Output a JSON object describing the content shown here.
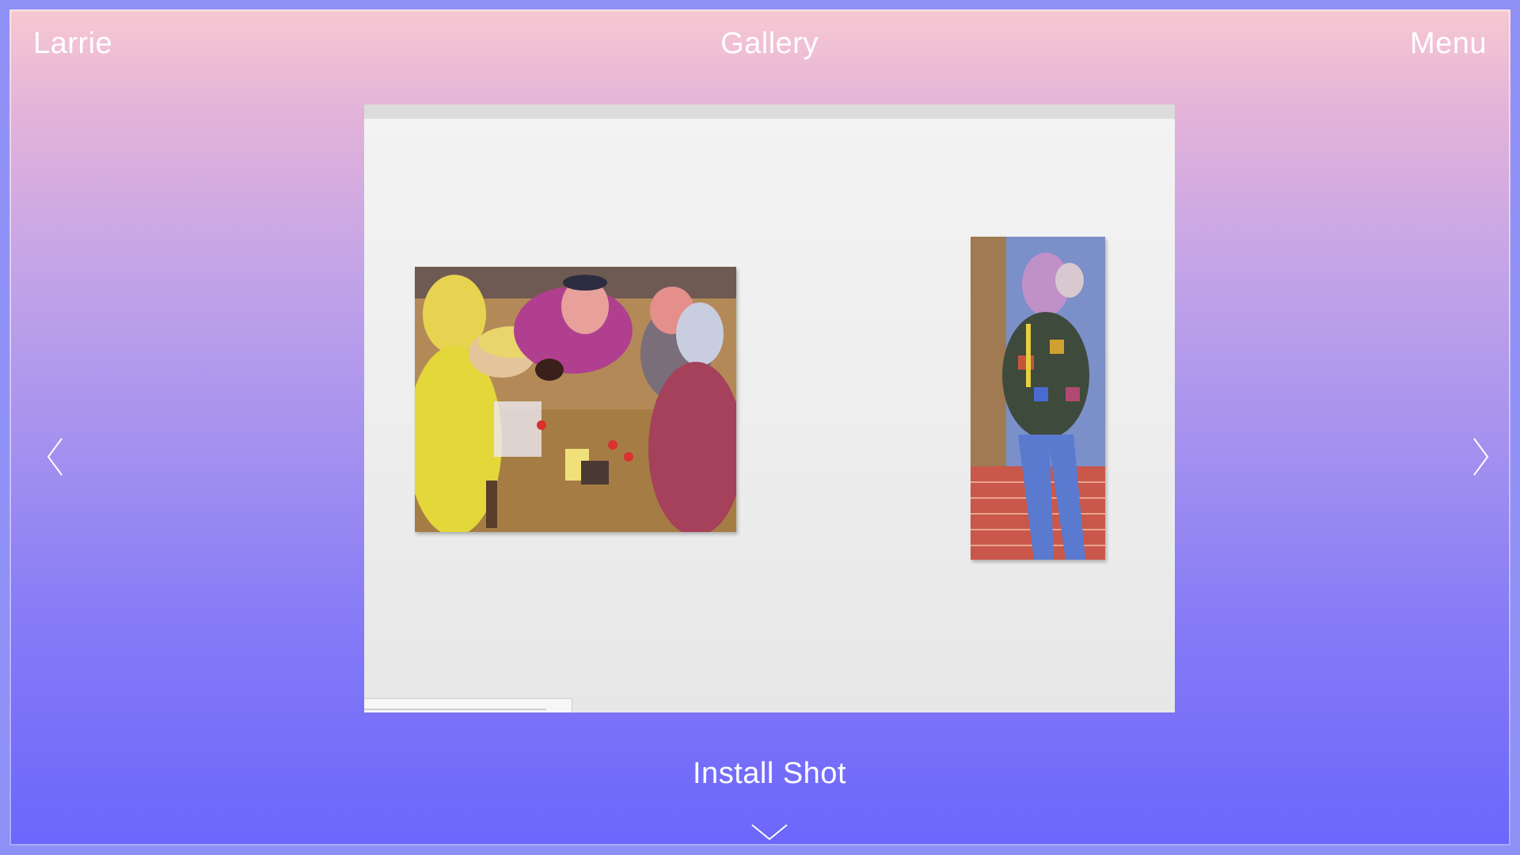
{
  "header": {
    "brand": "Larrie",
    "title": "Gallery",
    "menu_label": "Menu"
  },
  "slide": {
    "caption": "Install Shot"
  },
  "navigation": {
    "prev_icon": "chevron-left-icon",
    "next_icon": "chevron-right-icon",
    "scroll_icon": "chevron-down-icon"
  },
  "colors": {
    "gradient_top": "#f7c8d1",
    "gradient_bottom": "#6c66fb",
    "text": "#ffffff"
  }
}
